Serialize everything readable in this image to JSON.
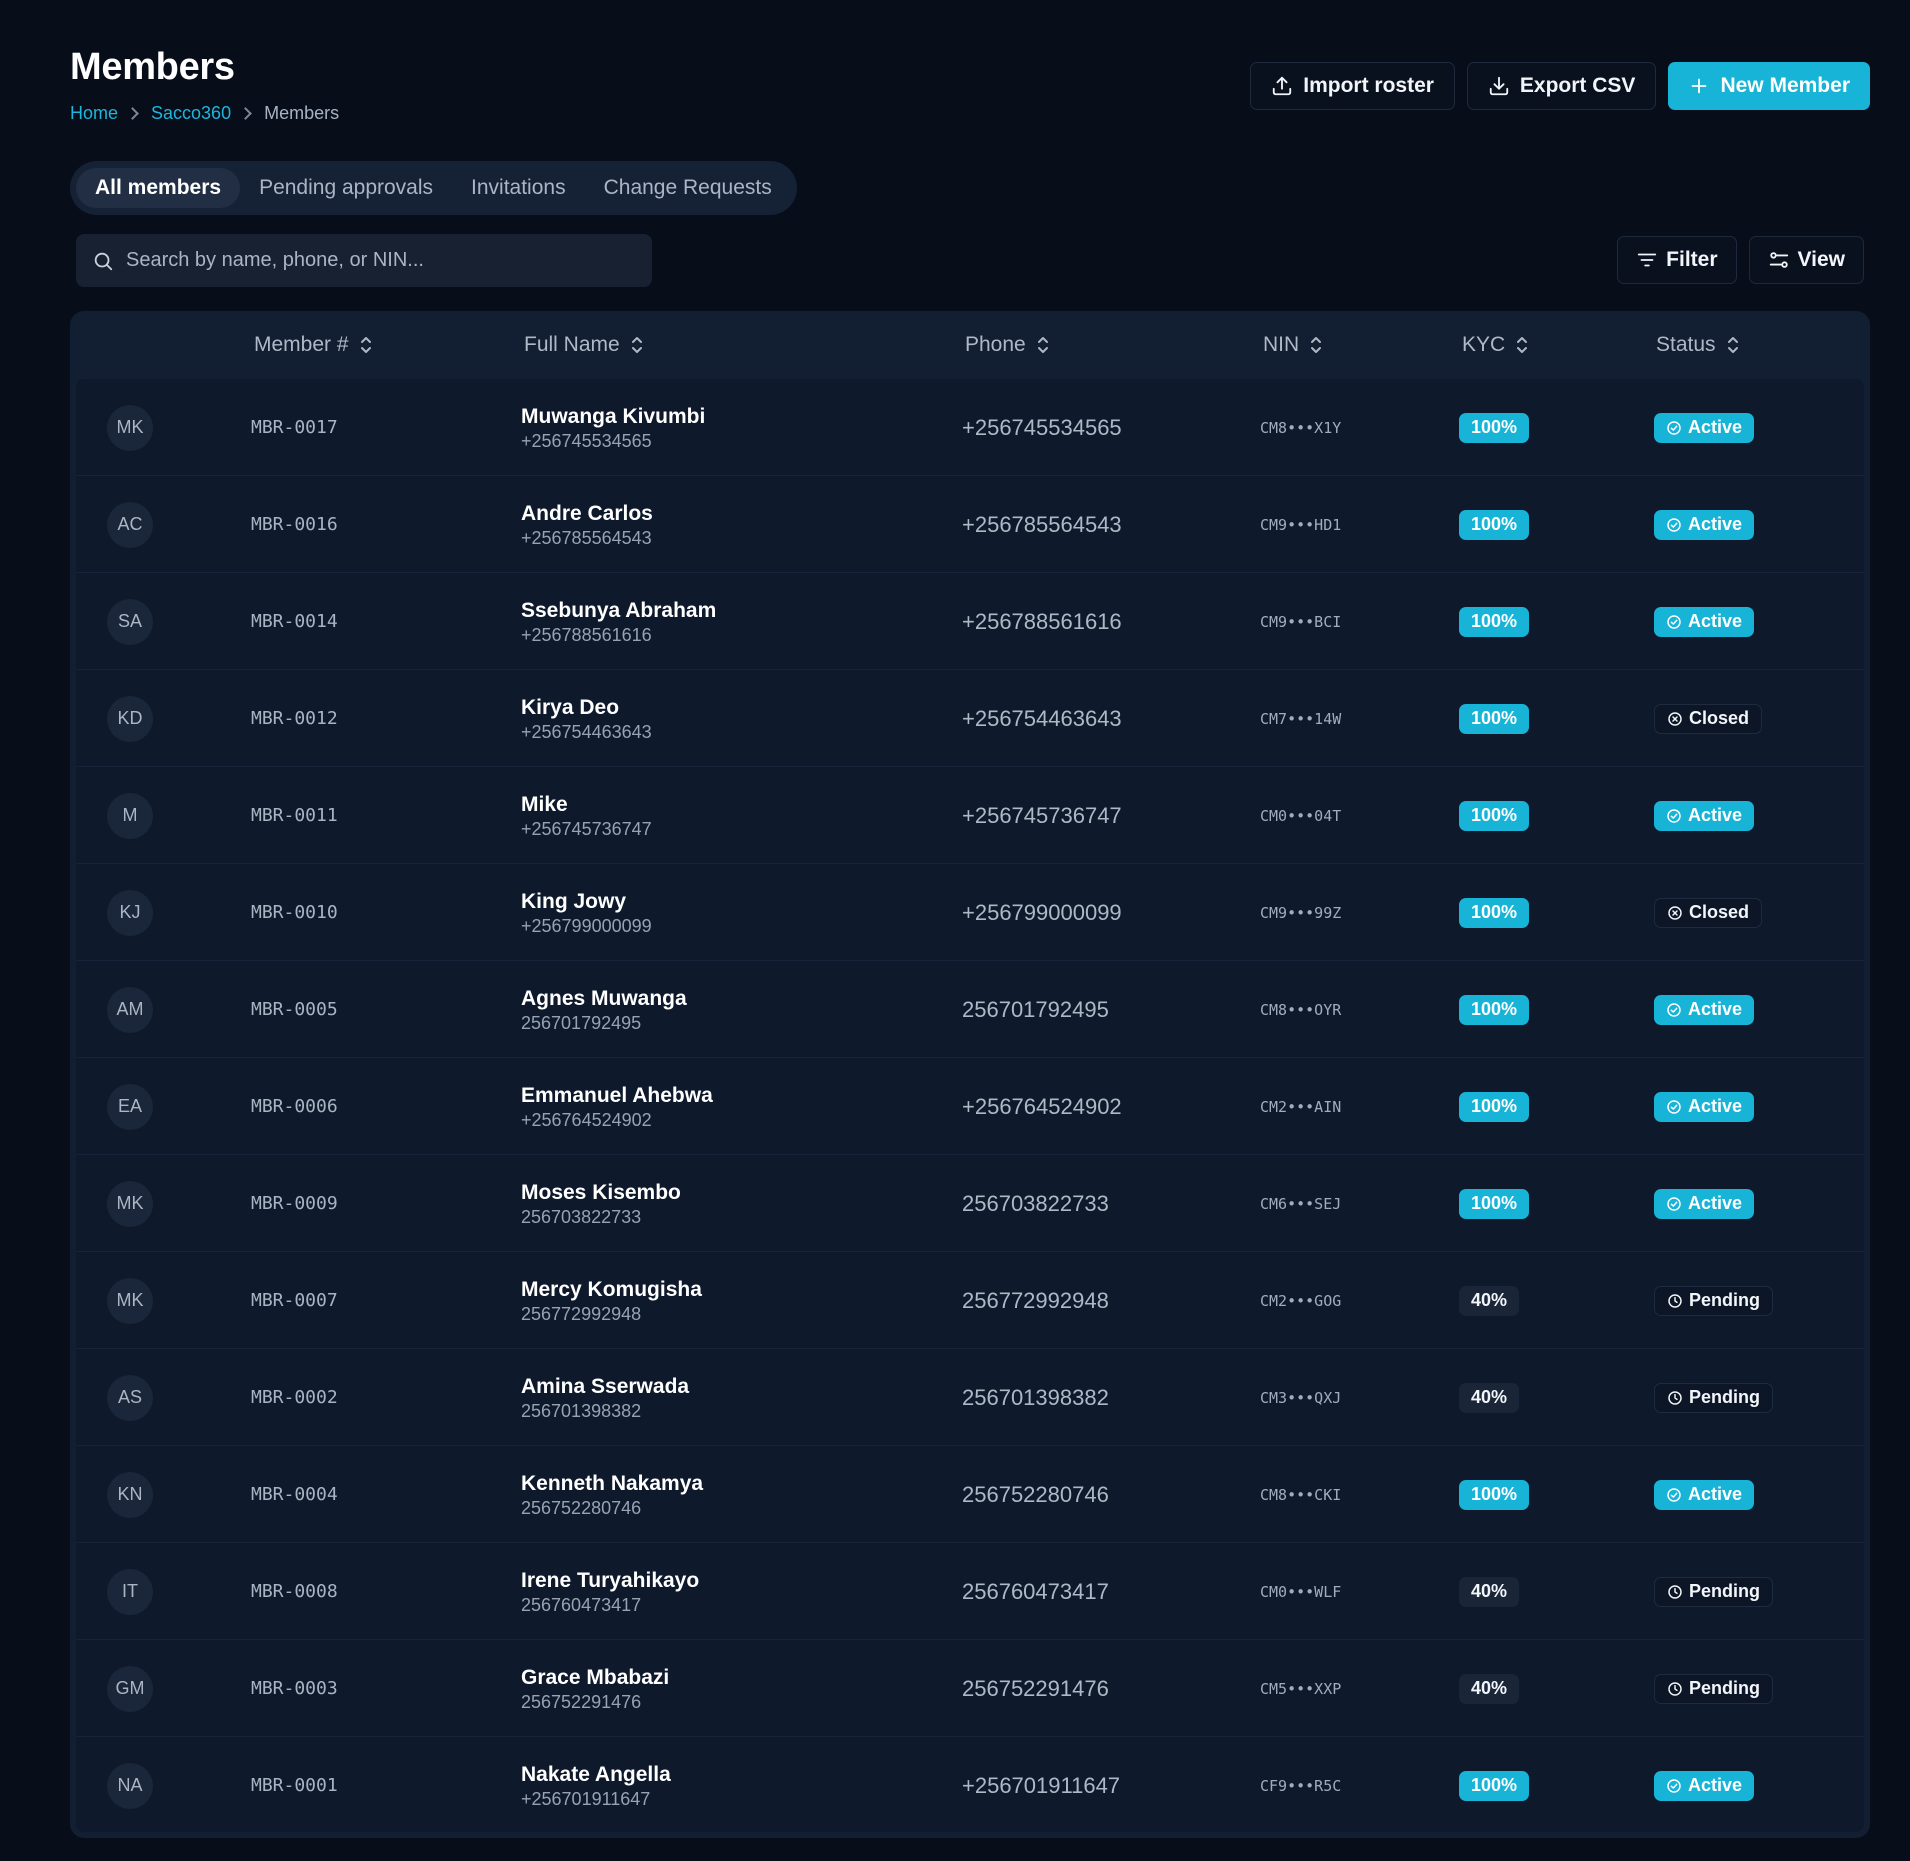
{
  "header": {
    "title": "Members",
    "breadcrumb": [
      "Home",
      "Sacco360",
      "Members"
    ]
  },
  "actions": {
    "import_label": "Import roster",
    "export_label": "Export CSV",
    "new_label": "New Member"
  },
  "tabs": [
    {
      "label": "All members",
      "active": true
    },
    {
      "label": "Pending approvals",
      "active": false
    },
    {
      "label": "Invitations",
      "active": false
    },
    {
      "label": "Change Requests",
      "active": false
    }
  ],
  "search": {
    "placeholder": "Search by name, phone, or NIN...",
    "value": ""
  },
  "toolbar": {
    "filter_label": "Filter",
    "view_label": "View"
  },
  "colors": {
    "accent": "#17b4d8",
    "background": "#070d19",
    "card": "#121e31"
  },
  "table": {
    "columns": [
      "Member #",
      "Full Name",
      "Phone",
      "NIN",
      "KYC",
      "Status"
    ],
    "rows": [
      {
        "initials": "MK",
        "member_no": "MBR-0017",
        "name": "Muwanga Kivumbi",
        "sub_phone": "+256745534565",
        "phone": "+256745534565",
        "nin": "CM8•••X1Y",
        "kyc": "100%",
        "status": "Active"
      },
      {
        "initials": "AC",
        "member_no": "MBR-0016",
        "name": "Andre Carlos",
        "sub_phone": "+256785564543",
        "phone": "+256785564543",
        "nin": "CM9•••HD1",
        "kyc": "100%",
        "status": "Active"
      },
      {
        "initials": "SA",
        "member_no": "MBR-0014",
        "name": "Ssebunya Abraham",
        "sub_phone": "+256788561616",
        "phone": "+256788561616",
        "nin": "CM9•••BCI",
        "kyc": "100%",
        "status": "Active"
      },
      {
        "initials": "KD",
        "member_no": "MBR-0012",
        "name": "Kirya Deo",
        "sub_phone": "+256754463643",
        "phone": "+256754463643",
        "nin": "CM7•••14W",
        "kyc": "100%",
        "status": "Closed"
      },
      {
        "initials": "M",
        "member_no": "MBR-0011",
        "name": "Mike",
        "sub_phone": "+256745736747",
        "phone": "+256745736747",
        "nin": "CM0•••04T",
        "kyc": "100%",
        "status": "Active"
      },
      {
        "initials": "KJ",
        "member_no": "MBR-0010",
        "name": "King Jowy",
        "sub_phone": "+256799000099",
        "phone": "+256799000099",
        "nin": "CM9•••99Z",
        "kyc": "100%",
        "status": "Closed"
      },
      {
        "initials": "AM",
        "member_no": "MBR-0005",
        "name": "Agnes Muwanga",
        "sub_phone": "256701792495",
        "phone": "256701792495",
        "nin": "CM8•••OYR",
        "kyc": "100%",
        "status": "Active"
      },
      {
        "initials": "EA",
        "member_no": "MBR-0006",
        "name": "Emmanuel Ahebwa",
        "sub_phone": "+256764524902",
        "phone": "+256764524902",
        "nin": "CM2•••AIN",
        "kyc": "100%",
        "status": "Active"
      },
      {
        "initials": "MK",
        "member_no": "MBR-0009",
        "name": "Moses Kisembo",
        "sub_phone": "256703822733",
        "phone": "256703822733",
        "nin": "CM6•••SEJ",
        "kyc": "100%",
        "status": "Active"
      },
      {
        "initials": "MK",
        "member_no": "MBR-0007",
        "name": "Mercy Komugisha",
        "sub_phone": "256772992948",
        "phone": "256772992948",
        "nin": "CM2•••GOG",
        "kyc": "40%",
        "status": "Pending"
      },
      {
        "initials": "AS",
        "member_no": "MBR-0002",
        "name": "Amina Sserwada",
        "sub_phone": "256701398382",
        "phone": "256701398382",
        "nin": "CM3•••QXJ",
        "kyc": "40%",
        "status": "Pending"
      },
      {
        "initials": "KN",
        "member_no": "MBR-0004",
        "name": "Kenneth Nakamya",
        "sub_phone": "256752280746",
        "phone": "256752280746",
        "nin": "CM8•••CKI",
        "kyc": "100%",
        "status": "Active"
      },
      {
        "initials": "IT",
        "member_no": "MBR-0008",
        "name": "Irene Turyahikayo",
        "sub_phone": "256760473417",
        "phone": "256760473417",
        "nin": "CM0•••WLF",
        "kyc": "40%",
        "status": "Pending"
      },
      {
        "initials": "GM",
        "member_no": "MBR-0003",
        "name": "Grace Mbabazi",
        "sub_phone": "256752291476",
        "phone": "256752291476",
        "nin": "CM5•••XXP",
        "kyc": "40%",
        "status": "Pending"
      },
      {
        "initials": "NA",
        "member_no": "MBR-0001",
        "name": "Nakate Angella",
        "sub_phone": "+256701911647",
        "phone": "+256701911647",
        "nin": "CF9•••R5C",
        "kyc": "100%",
        "status": "Active"
      }
    ]
  }
}
